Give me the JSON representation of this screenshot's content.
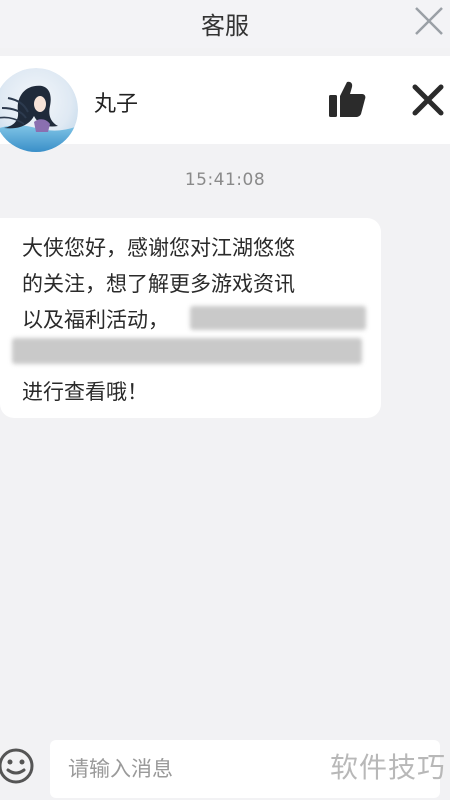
{
  "titlebar": {
    "title": "客服",
    "close_icon": "close-icon"
  },
  "agent": {
    "name": "丸子",
    "avatar_icon": "avatar",
    "like_icon": "thumbs-up-icon",
    "close_icon": "close-icon"
  },
  "chat": {
    "timestamp": "15:41:08",
    "message_lines": [
      "大侠您好，感谢您对江湖悠悠",
      "的关注，想了解更多游戏资讯",
      "以及福利活动，",
      "",
      "进行查看哦！"
    ]
  },
  "input": {
    "placeholder": "请输入消息",
    "emoji_icon": "emoji-icon"
  },
  "watermark": "软件技巧",
  "colors": {
    "background": "#f2f2f4",
    "bubble": "#ffffff",
    "text": "#2a2a2a",
    "muted": "#8a8a8a"
  }
}
